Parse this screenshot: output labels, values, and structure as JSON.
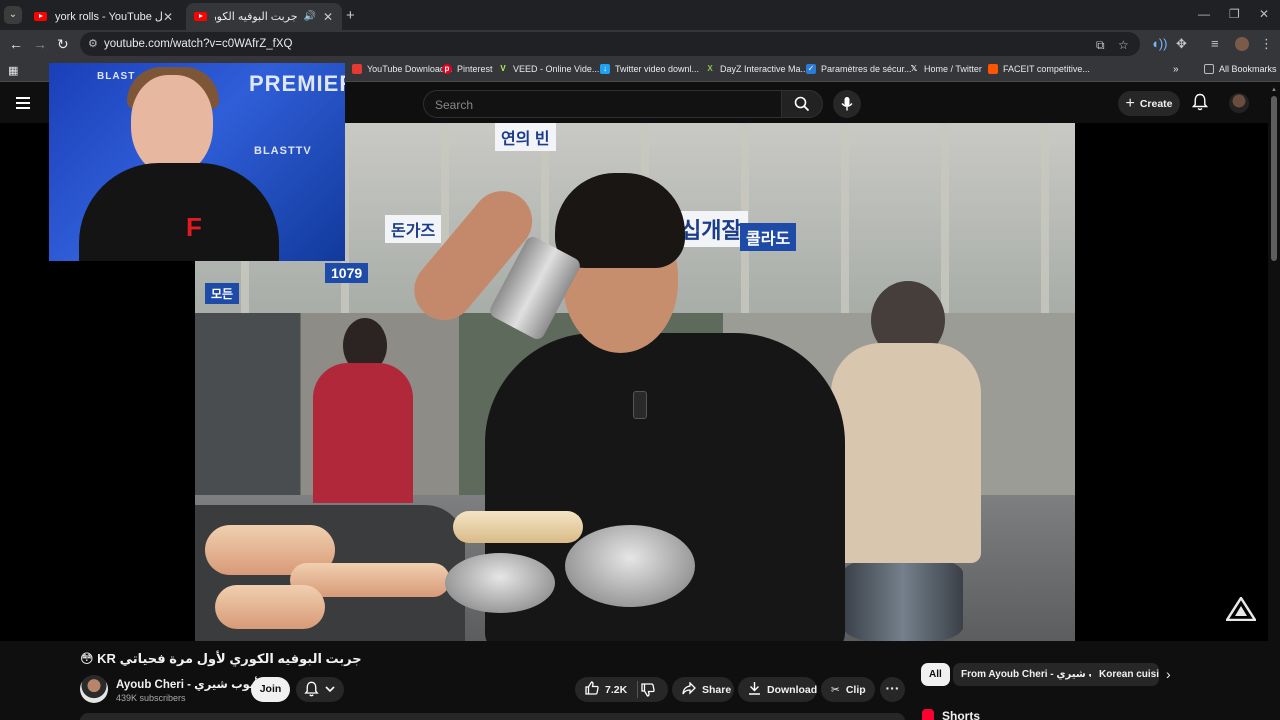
{
  "browser": {
    "tabs": [
      {
        "title": "york rolls - YouTube تحدي أكل",
        "active": false
      },
      {
        "title": "جربت البوفيه الكوري لأول مرة",
        "active": true
      }
    ],
    "url": "youtube.com/watch?v=c0WAfrZ_fXQ",
    "bookmarks": [
      {
        "label": "YouTube Download...",
        "icon": "youtube-download-icon",
        "color": "#e53935"
      },
      {
        "label": "Pinterest",
        "icon": "pinterest-icon",
        "color": "#e60023"
      },
      {
        "label": "VEED - Online Vide...",
        "icon": "veed-icon",
        "color": "#b8f34a"
      },
      {
        "label": "Twitter video downl...",
        "icon": "twitter-video-icon",
        "color": "#1da1f2"
      },
      {
        "label": "DayZ Interactive Ma...",
        "icon": "dayz-icon",
        "color": "#8bc34a"
      },
      {
        "label": "Paramètres de sécur...",
        "icon": "microsoft-icon",
        "color": "#2b7bd8"
      },
      {
        "label": "Home / Twitter",
        "icon": "x-icon",
        "color": "#000000"
      },
      {
        "label": "FACEIT competitive...",
        "icon": "faceit-icon",
        "color": "#ff5500"
      }
    ],
    "all_bookmarks": "All Bookmarks"
  },
  "youtube": {
    "search_placeholder": "Search",
    "create_label": "Create",
    "video_title": "جربت البوفيه الكوري لأول مرة فحياتي KR 😳",
    "channel_name": "Ayoub Cheri - أيوب شيري",
    "subscribers": "439K subscribers",
    "join_label": "Join",
    "likes": "7.2K",
    "share_label": "Share",
    "download_label": "Download",
    "clip_label": "Clip",
    "chips": [
      "All",
      "From Ayoub Cheri - أيوب شيري",
      "Korean cuisi"
    ],
    "shorts_label": "Shorts"
  },
  "pip_overlay": {
    "sponsor_words": [
      "BLAST",
      "PREMIER",
      "BLASTTV"
    ]
  },
  "colors": {
    "yt_red": "#ff0000",
    "background": "#0f0f0f",
    "chip_bg": "#272727"
  }
}
